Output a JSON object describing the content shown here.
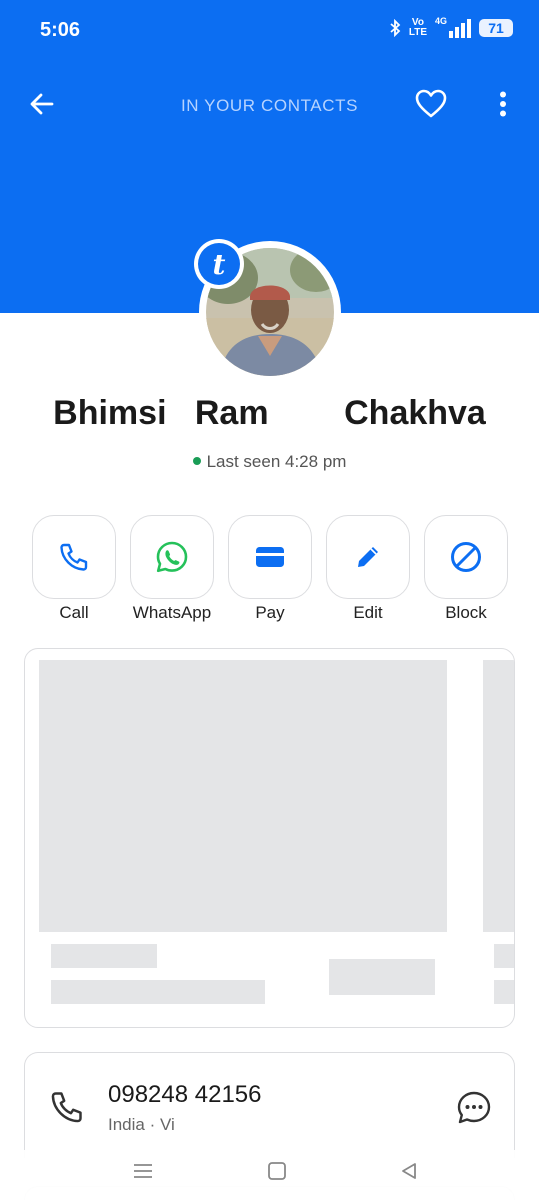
{
  "status_bar": {
    "time": "5:06",
    "volte_top": "Vo",
    "volte_bottom": "LTE",
    "network": "4G",
    "battery": "71"
  },
  "topbar": {
    "title": "IN YOUR CONTACTS",
    "back_icon": "arrow-left-icon",
    "favorite_icon": "heart-outline-icon",
    "more_icon": "more-vertical-icon"
  },
  "badge": {
    "letter": "t"
  },
  "contact": {
    "name": "Bhimsi   Ram        Chakhva",
    "last_seen": "Last seen 4:28 pm"
  },
  "actions": [
    {
      "label": "Call",
      "icon": "phone-icon"
    },
    {
      "label": "WhatsApp",
      "icon": "whatsapp-icon"
    },
    {
      "label": "Pay",
      "icon": "wallet-icon"
    },
    {
      "label": "Edit",
      "icon": "pencil-icon"
    },
    {
      "label": "Block",
      "icon": "block-icon"
    }
  ],
  "phone": {
    "number": "098248 42156",
    "detail": "India · Vi"
  },
  "colors": {
    "accent": "#0c6ef2",
    "online": "#1a9d56",
    "whatsapp": "#25c15a"
  }
}
